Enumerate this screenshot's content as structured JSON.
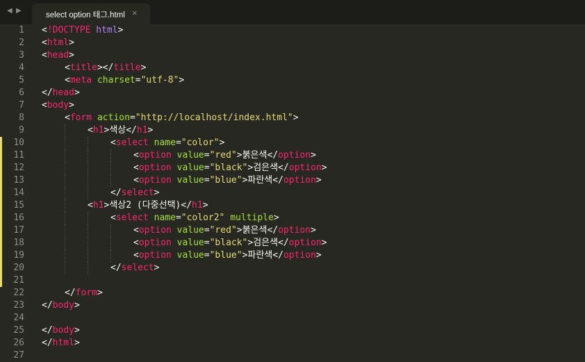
{
  "window": {
    "nav_left_glyph": "◀",
    "nav_right_glyph": "▶"
  },
  "tab": {
    "title": "select option 태그.html",
    "close_glyph": "×"
  },
  "editor": {
    "lines": [
      {
        "n": "1",
        "indent": 0,
        "modified": false,
        "tokens": [
          [
            "punct",
            "<"
          ],
          [
            "doctype",
            "!DOCTYPE"
          ],
          [
            "punct",
            " "
          ],
          [
            "kw",
            "html"
          ],
          [
            "punct",
            ">"
          ]
        ]
      },
      {
        "n": "2",
        "indent": 0,
        "modified": false,
        "tokens": [
          [
            "punct",
            "<"
          ],
          [
            "tag",
            "html"
          ],
          [
            "punct",
            ">"
          ]
        ]
      },
      {
        "n": "3",
        "indent": 0,
        "modified": false,
        "tokens": [
          [
            "punct",
            "<"
          ],
          [
            "tag",
            "head"
          ],
          [
            "punct",
            ">"
          ]
        ]
      },
      {
        "n": "4",
        "indent": 1,
        "modified": false,
        "tokens": [
          [
            "punct",
            "<"
          ],
          [
            "tag",
            "title"
          ],
          [
            "punct",
            "></"
          ],
          [
            "tag",
            "title"
          ],
          [
            "punct",
            ">"
          ]
        ]
      },
      {
        "n": "5",
        "indent": 1,
        "modified": false,
        "tokens": [
          [
            "punct",
            "<"
          ],
          [
            "tag",
            "meta"
          ],
          [
            "punct",
            " "
          ],
          [
            "attr",
            "charset"
          ],
          [
            "punct",
            "="
          ],
          [
            "str",
            "\"utf-8\""
          ],
          [
            "punct",
            ">"
          ]
        ]
      },
      {
        "n": "6",
        "indent": 0,
        "modified": false,
        "tokens": [
          [
            "punct",
            "</"
          ],
          [
            "tag",
            "head"
          ],
          [
            "punct",
            ">"
          ]
        ]
      },
      {
        "n": "7",
        "indent": 0,
        "modified": false,
        "tokens": [
          [
            "punct",
            "<"
          ],
          [
            "tag",
            "body"
          ],
          [
            "punct",
            ">"
          ]
        ]
      },
      {
        "n": "8",
        "indent": 1,
        "modified": false,
        "tokens": [
          [
            "punct",
            "<"
          ],
          [
            "tag",
            "form"
          ],
          [
            "punct",
            " "
          ],
          [
            "attr",
            "action"
          ],
          [
            "punct",
            "="
          ],
          [
            "str",
            "\"http://localhost/index.html\""
          ],
          [
            "punct",
            ">"
          ]
        ]
      },
      {
        "n": "9",
        "indent": 2,
        "modified": false,
        "tokens": [
          [
            "punct",
            "<"
          ],
          [
            "tag",
            "h1"
          ],
          [
            "punct",
            ">"
          ],
          [
            "text",
            "색상"
          ],
          [
            "punct",
            "</"
          ],
          [
            "tag",
            "h1"
          ],
          [
            "punct",
            ">"
          ]
        ]
      },
      {
        "n": "10",
        "indent": 3,
        "modified": true,
        "tokens": [
          [
            "punct",
            "<"
          ],
          [
            "tag",
            "select"
          ],
          [
            "punct",
            " "
          ],
          [
            "attr",
            "name"
          ],
          [
            "punct",
            "="
          ],
          [
            "str",
            "\"color\""
          ],
          [
            "punct",
            ">"
          ]
        ]
      },
      {
        "n": "11",
        "indent": 4,
        "modified": true,
        "tokens": [
          [
            "punct",
            "<"
          ],
          [
            "tag",
            "option"
          ],
          [
            "punct",
            " "
          ],
          [
            "attr",
            "value"
          ],
          [
            "punct",
            "="
          ],
          [
            "str",
            "\"red\""
          ],
          [
            "punct",
            ">"
          ],
          [
            "text",
            "붉은색"
          ],
          [
            "punct",
            "</"
          ],
          [
            "tag",
            "option"
          ],
          [
            "punct",
            ">"
          ]
        ]
      },
      {
        "n": "12",
        "indent": 4,
        "modified": true,
        "tokens": [
          [
            "punct",
            "<"
          ],
          [
            "tag",
            "option"
          ],
          [
            "punct",
            " "
          ],
          [
            "attr",
            "value"
          ],
          [
            "punct",
            "="
          ],
          [
            "str",
            "\"black\""
          ],
          [
            "punct",
            ">"
          ],
          [
            "text",
            "검은색"
          ],
          [
            "punct",
            "</"
          ],
          [
            "tag",
            "option"
          ],
          [
            "punct",
            ">"
          ]
        ]
      },
      {
        "n": "13",
        "indent": 4,
        "modified": true,
        "tokens": [
          [
            "punct",
            "<"
          ],
          [
            "tag",
            "option"
          ],
          [
            "punct",
            " "
          ],
          [
            "attr",
            "value"
          ],
          [
            "punct",
            "="
          ],
          [
            "str",
            "\"blue\""
          ],
          [
            "punct",
            ">"
          ],
          [
            "text",
            "파란색"
          ],
          [
            "punct",
            "</"
          ],
          [
            "tag",
            "option"
          ],
          [
            "punct",
            ">"
          ]
        ]
      },
      {
        "n": "14",
        "indent": 3,
        "modified": true,
        "tokens": [
          [
            "punct",
            "</"
          ],
          [
            "tag",
            "select"
          ],
          [
            "punct",
            ">"
          ]
        ]
      },
      {
        "n": "15",
        "indent": 2,
        "modified": true,
        "tokens": [
          [
            "punct",
            "<"
          ],
          [
            "tag",
            "h1"
          ],
          [
            "punct",
            ">"
          ],
          [
            "text",
            "색상2 (다중선택)"
          ],
          [
            "punct",
            "</"
          ],
          [
            "tag",
            "h1"
          ],
          [
            "punct",
            ">"
          ]
        ]
      },
      {
        "n": "16",
        "indent": 3,
        "modified": true,
        "tokens": [
          [
            "punct",
            "<"
          ],
          [
            "tag",
            "select"
          ],
          [
            "punct",
            " "
          ],
          [
            "attr",
            "name"
          ],
          [
            "punct",
            "="
          ],
          [
            "str",
            "\"color2\""
          ],
          [
            "punct",
            " "
          ],
          [
            "attr",
            "multiple"
          ],
          [
            "punct",
            ">"
          ]
        ]
      },
      {
        "n": "17",
        "indent": 4,
        "modified": true,
        "tokens": [
          [
            "punct",
            "<"
          ],
          [
            "tag",
            "option"
          ],
          [
            "punct",
            " "
          ],
          [
            "attr",
            "value"
          ],
          [
            "punct",
            "="
          ],
          [
            "str",
            "\"red\""
          ],
          [
            "punct",
            ">"
          ],
          [
            "text",
            "붉은색"
          ],
          [
            "punct",
            "</"
          ],
          [
            "tag",
            "option"
          ],
          [
            "punct",
            ">"
          ]
        ]
      },
      {
        "n": "18",
        "indent": 4,
        "modified": true,
        "tokens": [
          [
            "punct",
            "<"
          ],
          [
            "tag",
            "option"
          ],
          [
            "punct",
            " "
          ],
          [
            "attr",
            "value"
          ],
          [
            "punct",
            "="
          ],
          [
            "str",
            "\"black\""
          ],
          [
            "punct",
            ">"
          ],
          [
            "text",
            "검은색"
          ],
          [
            "punct",
            "</"
          ],
          [
            "tag",
            "option"
          ],
          [
            "punct",
            ">"
          ]
        ]
      },
      {
        "n": "19",
        "indent": 4,
        "modified": true,
        "tokens": [
          [
            "punct",
            "<"
          ],
          [
            "tag",
            "option"
          ],
          [
            "punct",
            " "
          ],
          [
            "attr",
            "value"
          ],
          [
            "punct",
            "="
          ],
          [
            "str",
            "\"blue\""
          ],
          [
            "punct",
            ">"
          ],
          [
            "text",
            "파란색"
          ],
          [
            "punct",
            "</"
          ],
          [
            "tag",
            "option"
          ],
          [
            "punct",
            ">"
          ]
        ]
      },
      {
        "n": "20",
        "indent": 3,
        "modified": true,
        "tokens": [
          [
            "punct",
            "</"
          ],
          [
            "tag",
            "select"
          ],
          [
            "punct",
            ">"
          ]
        ]
      },
      {
        "n": "21",
        "indent": 0,
        "modified": true,
        "tokens": []
      },
      {
        "n": "22",
        "indent": 1,
        "modified": false,
        "tokens": [
          [
            "punct",
            "</"
          ],
          [
            "tag",
            "form"
          ],
          [
            "punct",
            ">"
          ]
        ]
      },
      {
        "n": "23",
        "indent": 0,
        "modified": false,
        "tokens": [
          [
            "punct",
            "</"
          ],
          [
            "tag",
            "body"
          ],
          [
            "punct",
            ">"
          ]
        ]
      },
      {
        "n": "24",
        "indent": 0,
        "modified": false,
        "tokens": []
      },
      {
        "n": "25",
        "indent": 0,
        "modified": false,
        "tokens": [
          [
            "punct",
            "</"
          ],
          [
            "tag",
            "body"
          ],
          [
            "punct",
            ">"
          ]
        ]
      },
      {
        "n": "26",
        "indent": 0,
        "modified": false,
        "tokens": [
          [
            "punct",
            "</"
          ],
          [
            "tag",
            "html"
          ],
          [
            "punct",
            ">"
          ]
        ]
      },
      {
        "n": "27",
        "indent": 0,
        "modified": false,
        "tokens": []
      }
    ]
  }
}
